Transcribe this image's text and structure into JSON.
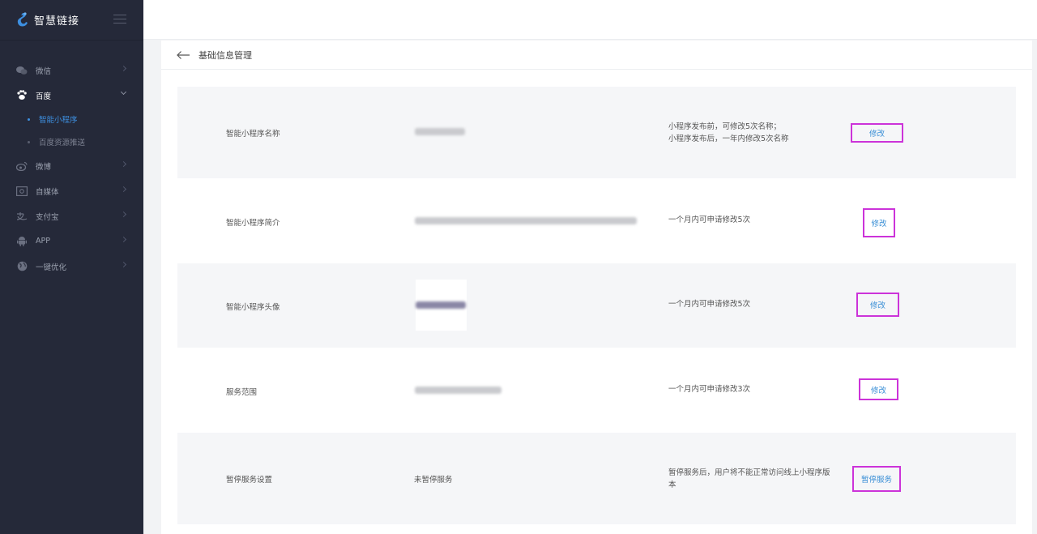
{
  "brand": {
    "name": "智慧链接"
  },
  "sidebar": {
    "items": [
      {
        "label": "微信",
        "icon": "wechat-icon"
      },
      {
        "label": "百度",
        "icon": "paw-icon",
        "expanded": true,
        "children": [
          {
            "label": "智能小程序",
            "active": true
          },
          {
            "label": "百度资源推送",
            "active": false
          }
        ]
      },
      {
        "label": "微博",
        "icon": "weibo-icon"
      },
      {
        "label": "自媒体",
        "icon": "media-icon"
      },
      {
        "label": "支付宝",
        "icon": "alipay-icon"
      },
      {
        "label": "APP",
        "icon": "android-icon"
      },
      {
        "label": "一键优化",
        "icon": "globe-icon"
      }
    ]
  },
  "page": {
    "title": "基础信息管理"
  },
  "rows": [
    {
      "label": "智能小程序名称",
      "value": "",
      "note": [
        "小程序发布前，可修改5次名称；",
        "小程序发布后，一年内修改5次名称"
      ],
      "action": "修改"
    },
    {
      "label": "智能小程序简介",
      "value": "",
      "note": [
        "一个月内可申请修改5次"
      ],
      "action": "修改"
    },
    {
      "label": "智能小程序头像",
      "value": "",
      "note": [
        "一个月内可申请修改5次"
      ],
      "action": "修改"
    },
    {
      "label": "服务范围",
      "value": "",
      "note": [
        "一个月内可申请修改3次"
      ],
      "action": "修改"
    },
    {
      "label": "暂停服务设置",
      "value": "未暂停服务",
      "note": [
        "暂停服务后，用户将不能正常访问线上小程序版",
        "本"
      ],
      "action": "暂停服务"
    }
  ],
  "colors": {
    "sidebar_bg": "#252939",
    "active_blue": "#3d8fe0",
    "highlight_border": "#cc33d9",
    "link_blue": "#3a8fd6"
  }
}
